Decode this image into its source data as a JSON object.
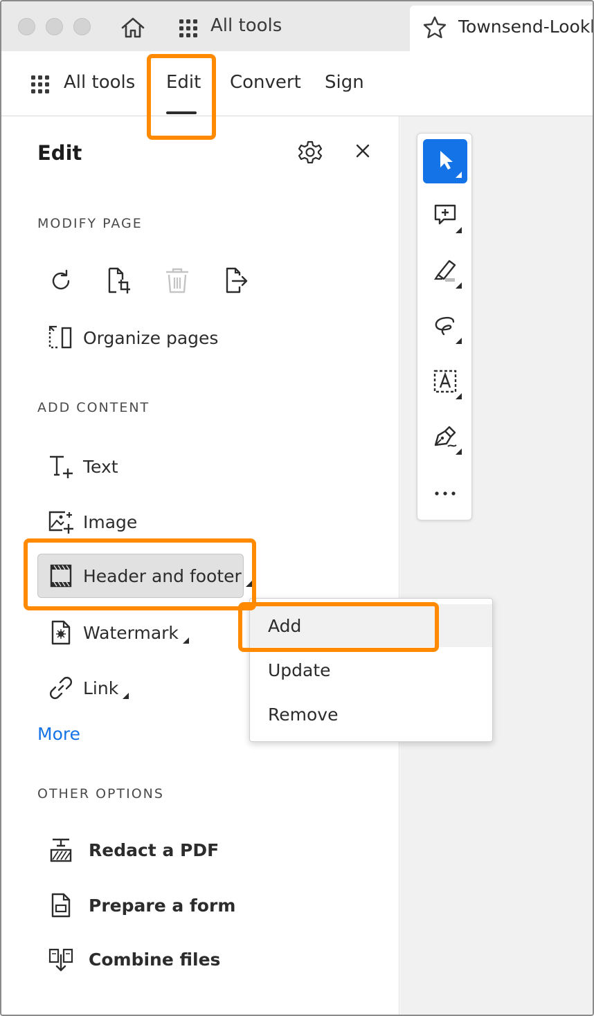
{
  "titlebar": {
    "all_tools_label": "All tools",
    "document_title": "Townsend-Lookb"
  },
  "nav": {
    "all_tools_label": "All tools",
    "tabs": [
      {
        "label": "Edit",
        "active": true
      },
      {
        "label": "Convert",
        "active": false
      },
      {
        "label": "Sign",
        "active": false
      }
    ]
  },
  "panel": {
    "title": "Edit",
    "modify_page": {
      "heading": "MODIFY PAGE",
      "icons": [
        "rotate-icon",
        "crop-icon",
        "delete-icon",
        "extract-icon"
      ],
      "organize_label": "Organize pages"
    },
    "add_content": {
      "heading": "ADD CONTENT",
      "items": [
        {
          "label": "Text",
          "icon": "add-text-icon"
        },
        {
          "label": "Image",
          "icon": "add-image-icon"
        },
        {
          "label": "Header and footer",
          "icon": "header-footer-icon"
        },
        {
          "label": "Watermark",
          "icon": "watermark-icon"
        },
        {
          "label": "Link",
          "icon": "link-icon"
        }
      ],
      "more_label": "More"
    },
    "other_options": {
      "heading": "OTHER OPTIONS",
      "items": [
        {
          "label": "Redact a PDF",
          "icon": "redact-icon"
        },
        {
          "label": "Prepare a form",
          "icon": "form-icon"
        },
        {
          "label": "Combine files",
          "icon": "combine-icon"
        }
      ]
    }
  },
  "context_menu": {
    "items": [
      {
        "label": "Add"
      },
      {
        "label": "Update"
      },
      {
        "label": "Remove"
      }
    ]
  },
  "toolbar": {
    "tools": [
      "select-icon",
      "add-comment-icon",
      "highlight-icon",
      "draw-icon",
      "text-select-icon",
      "sign-icon",
      "more-icon"
    ]
  },
  "colors": {
    "accent": "#1473e6",
    "highlight": "#ff8a00",
    "titlebar_bg": "#e9e9e9",
    "canvas_bg": "#f1f1f1"
  }
}
